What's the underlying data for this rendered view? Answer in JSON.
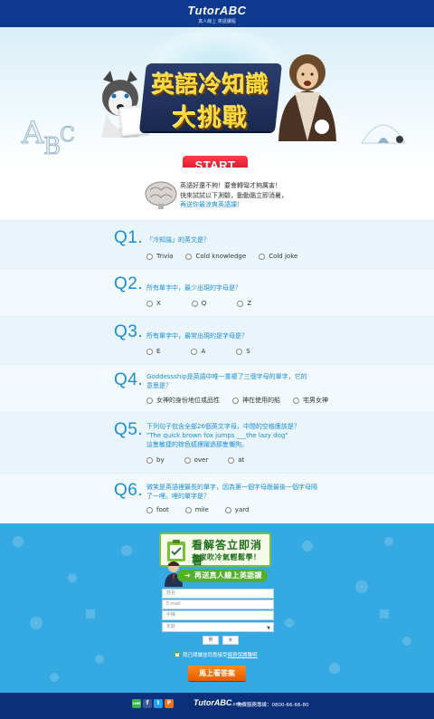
{
  "header": {
    "logo": "TutorABC",
    "tagline": "真人線上 英語課程"
  },
  "hero": {
    "title_line1": "英語冷知識",
    "title_line2": "大挑戰",
    "start_label": "START"
  },
  "intro": {
    "line1": "英語好還不夠！要會轉彎才夠厲害！",
    "line2": "快來試試以下測驗，動動腦立即消暑，",
    "line3": "再送你最涼爽英語課！"
  },
  "questions": [
    {
      "num": "Q1.",
      "text": "「冷知識」的英文是？",
      "options": [
        "Trivia",
        "Cold knowledge",
        "Cold joke"
      ]
    },
    {
      "num": "Q2.",
      "text": "所有單字中，最少出現的字母是？",
      "options": [
        "X",
        "Q",
        "Z"
      ]
    },
    {
      "num": "Q3.",
      "text": "所有單字中，最常出現的是字母是？",
      "options": [
        "E",
        "A",
        "S"
      ]
    },
    {
      "num": "Q4.",
      "text": "Goddessship是英語中唯一重複了三個字母的單字，它的意思是？",
      "options": [
        "女神的身份地位或品性",
        "神在使用的船",
        "宅男女神"
      ]
    },
    {
      "num": "Q5.",
      "text_a": "下列句子包含全部26個英文字母，中間的空格應該是？",
      "text_b": "\"The quick brown fox jumps ___the lazy dog\"",
      "text_c": "這隻敏捷的棕色狐狸躍過那隻懶狗。",
      "options": [
        "by",
        "over",
        "at"
      ]
    },
    {
      "num": "Q6.",
      "text": "微笑是英語裡最長的單字，因為第一個字母跟最後一個字母隔了一哩。哩的單字是？",
      "options": [
        "foot",
        "mile",
        "yard"
      ]
    }
  ],
  "form": {
    "banner_line1": "看解答立即消暑",
    "banner_line2": "在家吹冷氣輕鬆學！",
    "green_bar": "再送真人線上英語課",
    "name_placeholder": "姓名",
    "email_placeholder": "E-mail",
    "phone_placeholder": "手機",
    "age_placeholder": "年齡",
    "gender_male": "男",
    "gender_female": "女",
    "agree_text": "我已閱讀並同意接受",
    "agree_link": "個資保護聲明",
    "submit_label": "馬上看答案"
  },
  "footer": {
    "social": [
      "LINE",
      "f",
      "t",
      "P"
    ],
    "logo": "TutorABC",
    "logo_suffix": ".com",
    "phone": "免費服務專線：0800-66-66-80"
  },
  "colors": {
    "brand_blue": "#0d3a8e",
    "accent_blue": "#1b8ed6",
    "start_red": "#e0192f",
    "submit_orange": "#f07010",
    "form_green": "#52b02d"
  }
}
